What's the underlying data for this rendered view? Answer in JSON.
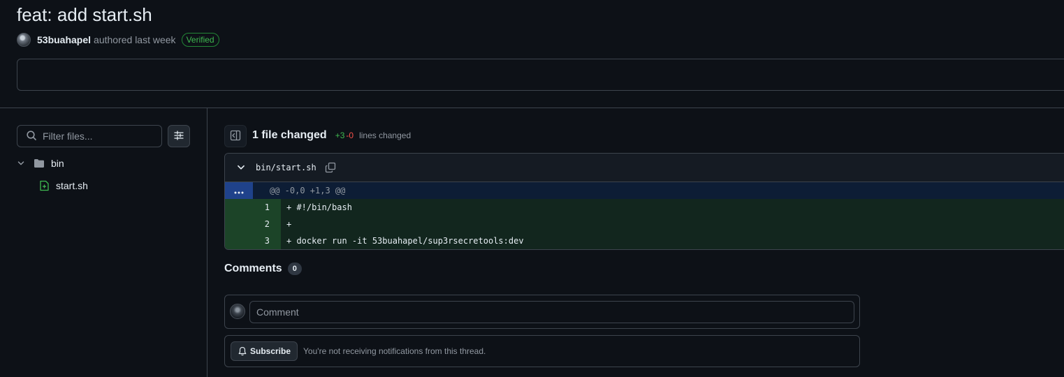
{
  "commit": {
    "title": "feat: add start.sh",
    "author": "53buahapel",
    "authored_text": "authored last week",
    "verified_label": "Verified"
  },
  "sidebar": {
    "filter_placeholder": "Filter files...",
    "tree": {
      "folder": "bin",
      "file": "start.sh"
    }
  },
  "summary": {
    "files_changed": "1 file changed",
    "additions": "+3",
    "deletions": "-0",
    "lines_changed": "lines changed"
  },
  "diff": {
    "path": "bin/start.sh",
    "hunk": "@@ -0,0 +1,3 @@",
    "lines": [
      {
        "num": "1",
        "code": "+ #!/bin/bash"
      },
      {
        "num": "2",
        "code": "+"
      },
      {
        "num": "3",
        "code": "+ docker run -it 53buahapel/sup3rsecretools:dev"
      }
    ]
  },
  "comments": {
    "heading": "Comments",
    "count": "0",
    "placeholder": "Comment",
    "subscribe_label": "Subscribe",
    "notification_text": "You're not receiving notifications from this thread."
  }
}
